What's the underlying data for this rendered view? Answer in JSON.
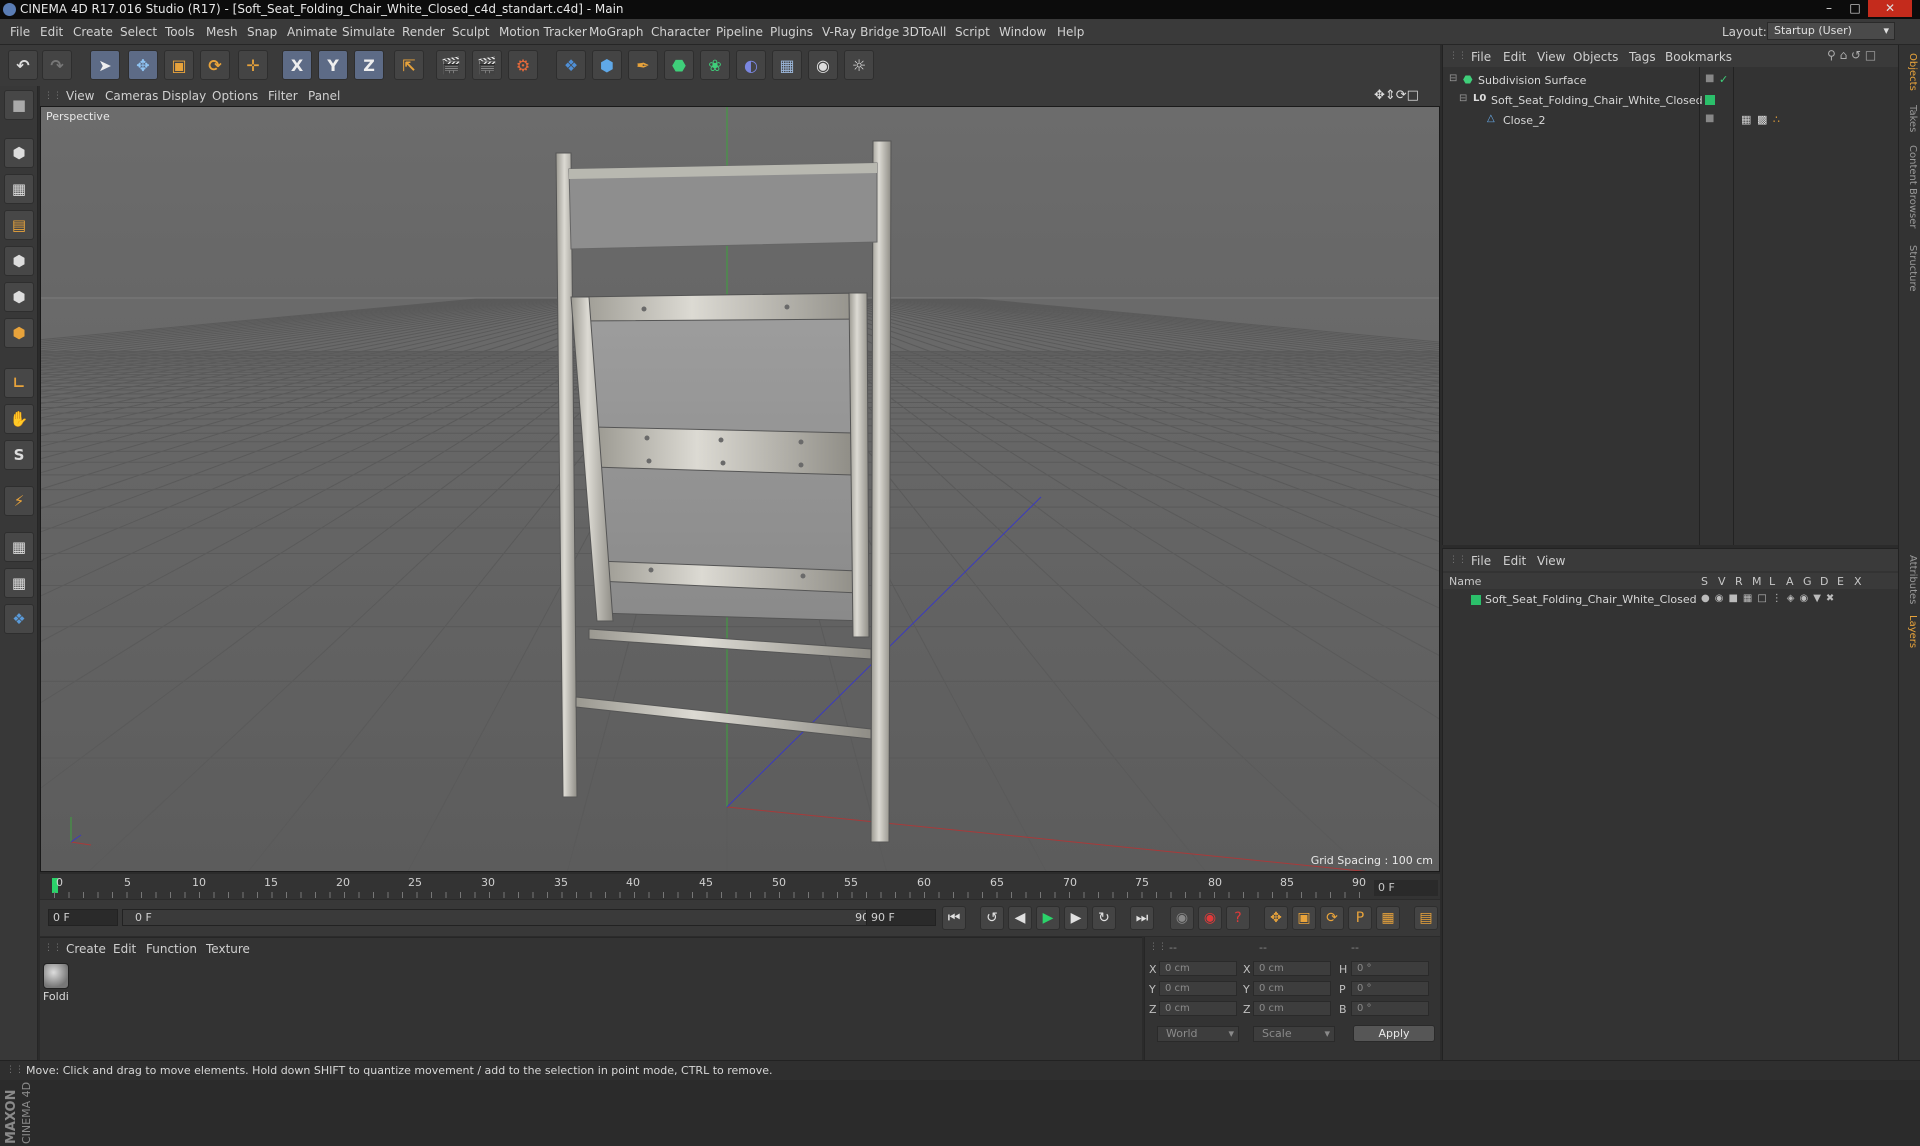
{
  "window": {
    "title": "CINEMA 4D R17.016 Studio (R17) - [Soft_Seat_Folding_Chair_White_Closed_c4d_standart.c4d] - Main"
  },
  "menubar": {
    "items": [
      "File",
      "Edit",
      "Create",
      "Select",
      "Tools",
      "Mesh",
      "Snap",
      "Animate",
      "Simulate",
      "Render",
      "Sculpt",
      "Motion Tracker",
      "MoGraph",
      "Character",
      "Pipeline",
      "Plugins",
      "V-Ray Bridge",
      "3DToAll",
      "Script",
      "Window",
      "Help"
    ],
    "layout_label": "Layout:",
    "layout_value": "Startup (User)"
  },
  "toolbar": {
    "x_axis": "X",
    "y_axis": "Y",
    "z_axis": "Z"
  },
  "viewport": {
    "menu": [
      "View",
      "Cameras",
      "Display",
      "Options",
      "Filter",
      "Panel"
    ],
    "label": "Perspective",
    "grid_spacing": "Grid Spacing : 100 cm",
    "background_color": "#6a6a6a"
  },
  "timeline": {
    "ticks": [
      "0",
      "5",
      "10",
      "15",
      "20",
      "25",
      "30",
      "35",
      "40",
      "45",
      "50",
      "55",
      "60",
      "65",
      "70",
      "75",
      "80",
      "85",
      "90"
    ],
    "current_frame": "0 F",
    "start_field": "0 F",
    "range_start": "0 F",
    "range_end": "90 F",
    "end_field": "90 F"
  },
  "material_manager": {
    "menu": [
      "Create",
      "Edit",
      "Function",
      "Texture"
    ],
    "material_name": "Foldi"
  },
  "coordinates": {
    "header": [
      "--",
      "--",
      "--"
    ],
    "rows": [
      {
        "l1": "X",
        "v1": "0 cm",
        "l2": "X",
        "v2": "0 cm",
        "l3": "H",
        "v3": "0 °"
      },
      {
        "l1": "Y",
        "v1": "0 cm",
        "l2": "Y",
        "v2": "0 cm",
        "l3": "P",
        "v3": "0 °"
      },
      {
        "l1": "Z",
        "v1": "0 cm",
        "l2": "Z",
        "v2": "0 cm",
        "l3": "B",
        "v3": "0 °"
      }
    ],
    "space": "World",
    "mode": "Scale",
    "apply_label": "Apply"
  },
  "object_manager": {
    "menu": [
      "File",
      "Edit",
      "View",
      "Objects",
      "Tags",
      "Bookmarks"
    ],
    "objects": [
      {
        "name": "Subdivision Surface"
      },
      {
        "name": "Soft_Seat_Folding_Chair_White_Closed"
      },
      {
        "name": "Close_2"
      }
    ]
  },
  "layer_manager": {
    "menu": [
      "File",
      "Edit",
      "View"
    ],
    "header_name": "Name",
    "columns": [
      "S",
      "V",
      "R",
      "M",
      "L",
      "A",
      "G",
      "D",
      "E",
      "X"
    ],
    "layers": [
      {
        "name": "Soft_Seat_Folding_Chair_White_Closed",
        "color": "#2bbf6a"
      }
    ]
  },
  "right_tabs": [
    "Objects",
    "Takes",
    "Content Browser",
    "Structure",
    "Attributes",
    "Layers"
  ],
  "status": {
    "text": "Move: Click and drag to move elements. Hold down SHIFT to quantize movement / add to the selection in point mode, CTRL to remove."
  },
  "brand": {
    "maxon": "MAXON",
    "cinema": "CINEMA 4D"
  },
  "colors": {
    "accent": "#e8a33b",
    "selection": "#5d6b86",
    "layer_green": "#2bbf6a"
  }
}
